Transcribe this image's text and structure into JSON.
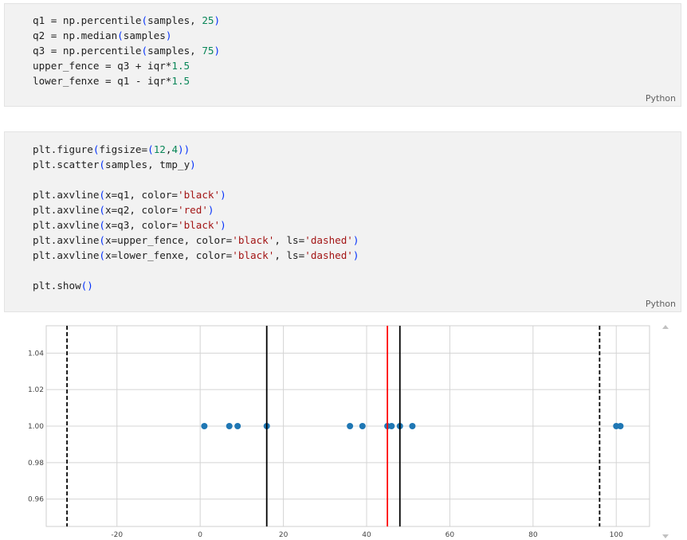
{
  "cells": [
    {
      "language": "Python",
      "lines": [
        [
          {
            "t": "q1 = np.percentile",
            "c": "op"
          },
          {
            "t": "(",
            "c": "paren"
          },
          {
            "t": "samples, ",
            "c": "op"
          },
          {
            "t": "25",
            "c": "num"
          },
          {
            "t": ")",
            "c": "paren"
          }
        ],
        [
          {
            "t": "q2 = np.median",
            "c": "op"
          },
          {
            "t": "(",
            "c": "paren"
          },
          {
            "t": "samples",
            "c": "op"
          },
          {
            "t": ")",
            "c": "paren"
          }
        ],
        [
          {
            "t": "q3 = np.percentile",
            "c": "op"
          },
          {
            "t": "(",
            "c": "paren"
          },
          {
            "t": "samples, ",
            "c": "op"
          },
          {
            "t": "75",
            "c": "num"
          },
          {
            "t": ")",
            "c": "paren"
          }
        ],
        [
          {
            "t": "upper_fence = q3 + iqr*",
            "c": "op"
          },
          {
            "t": "1.5",
            "c": "num"
          }
        ],
        [
          {
            "t": "lower_fenxe = q1 - iqr*",
            "c": "op"
          },
          {
            "t": "1.5",
            "c": "num"
          }
        ]
      ]
    },
    {
      "language": "Python",
      "lines": [
        [
          {
            "t": "plt.figure",
            "c": "op"
          },
          {
            "t": "(",
            "c": "paren"
          },
          {
            "t": "figsize=",
            "c": "op"
          },
          {
            "t": "(",
            "c": "paren"
          },
          {
            "t": "12",
            "c": "num"
          },
          {
            "t": ",",
            "c": "op"
          },
          {
            "t": "4",
            "c": "num"
          },
          {
            "t": "))",
            "c": "paren"
          }
        ],
        [
          {
            "t": "plt.scatter",
            "c": "op"
          },
          {
            "t": "(",
            "c": "paren"
          },
          {
            "t": "samples, tmp_y",
            "c": "op"
          },
          {
            "t": ")",
            "c": "paren"
          }
        ],
        [],
        [
          {
            "t": "plt.axvline",
            "c": "op"
          },
          {
            "t": "(",
            "c": "paren"
          },
          {
            "t": "x=q1, color=",
            "c": "op"
          },
          {
            "t": "'black'",
            "c": "str"
          },
          {
            "t": ")",
            "c": "paren"
          }
        ],
        [
          {
            "t": "plt.axvline",
            "c": "op"
          },
          {
            "t": "(",
            "c": "paren"
          },
          {
            "t": "x=q2, color=",
            "c": "op"
          },
          {
            "t": "'red'",
            "c": "str"
          },
          {
            "t": ")",
            "c": "paren"
          }
        ],
        [
          {
            "t": "plt.axvline",
            "c": "op"
          },
          {
            "t": "(",
            "c": "paren"
          },
          {
            "t": "x=q3, color=",
            "c": "op"
          },
          {
            "t": "'black'",
            "c": "str"
          },
          {
            "t": ")",
            "c": "paren"
          }
        ],
        [
          {
            "t": "plt.axvline",
            "c": "op"
          },
          {
            "t": "(",
            "c": "paren"
          },
          {
            "t": "x=upper_fence, color=",
            "c": "op"
          },
          {
            "t": "'black'",
            "c": "str"
          },
          {
            "t": ", ls=",
            "c": "op"
          },
          {
            "t": "'dashed'",
            "c": "str"
          },
          {
            "t": ")",
            "c": "paren"
          }
        ],
        [
          {
            "t": "plt.axvline",
            "c": "op"
          },
          {
            "t": "(",
            "c": "paren"
          },
          {
            "t": "x=lower_fenxe, color=",
            "c": "op"
          },
          {
            "t": "'black'",
            "c": "str"
          },
          {
            "t": ", ls=",
            "c": "op"
          },
          {
            "t": "'dashed'",
            "c": "str"
          },
          {
            "t": ")",
            "c": "paren"
          }
        ],
        [],
        [
          {
            "t": "plt.show",
            "c": "op"
          },
          {
            "t": "()",
            "c": "paren"
          }
        ]
      ]
    }
  ],
  "chart_data": {
    "type": "scatter",
    "title": "",
    "xlabel": "",
    "ylabel": "",
    "xlim": [
      -37,
      108
    ],
    "ylim": [
      0.945,
      1.055
    ],
    "xticks": [
      -20,
      0,
      20,
      40,
      60,
      80,
      100
    ],
    "xtick_labels": [
      "-20",
      "0",
      "20",
      "40",
      "60",
      "80",
      "100"
    ],
    "yticks": [
      0.96,
      0.98,
      1.0,
      1.02,
      1.04
    ],
    "ytick_labels": [
      "0.96",
      "0.98",
      "1.00",
      "1.02",
      "1.04"
    ],
    "grid": true,
    "points": {
      "x": [
        1,
        7,
        9,
        16,
        36,
        39,
        45,
        46,
        48,
        51,
        100,
        101
      ],
      "y": [
        1,
        1,
        1,
        1,
        1,
        1,
        1,
        1,
        1,
        1,
        1,
        1
      ],
      "color": "#1f77b4"
    },
    "vlines": [
      {
        "x": 16,
        "color": "#000000",
        "style": "solid"
      },
      {
        "x": 45,
        "color": "#ff0000",
        "style": "solid"
      },
      {
        "x": 48,
        "color": "#000000",
        "style": "solid"
      },
      {
        "x": 96,
        "color": "#000000",
        "style": "dashed"
      },
      {
        "x": -32,
        "color": "#000000",
        "style": "dashed"
      }
    ]
  }
}
